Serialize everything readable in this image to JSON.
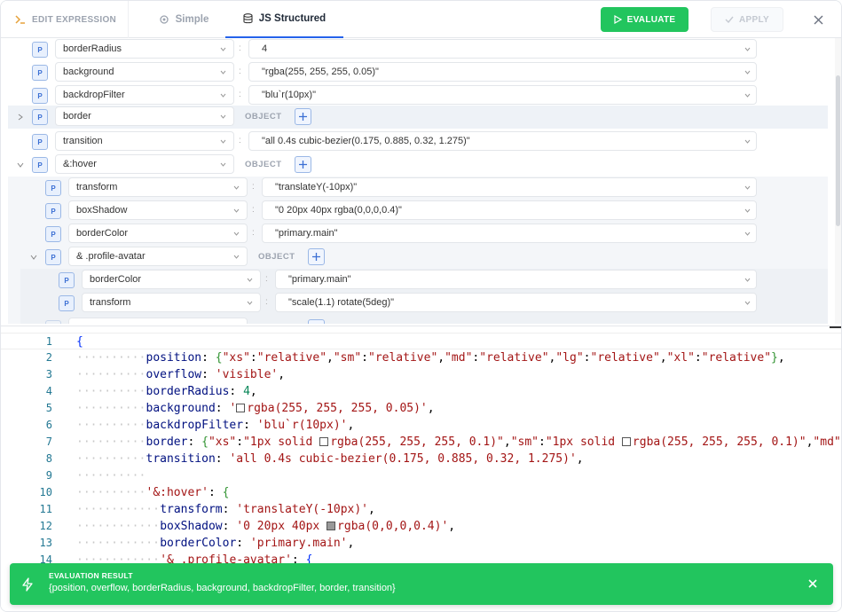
{
  "header": {
    "tabs": [
      {
        "label": "EDIT EXPRESSION",
        "icon": "terminal-icon"
      },
      {
        "label": "Simple",
        "icon": "gear-icon"
      },
      {
        "label": "JS Structured",
        "icon": "database-icon"
      }
    ],
    "evaluate_label": "EVALUATE",
    "apply_label": "APPLY"
  },
  "tree": {
    "rows": [
      {
        "badge": "P",
        "key": "borderRadius",
        "value": "4"
      },
      {
        "badge": "P",
        "key": "background",
        "value": "\"rgba(255, 255, 255, 0.05)\""
      },
      {
        "badge": "P",
        "key": "backdropFilter",
        "value": "\"blu`r(10px)\""
      },
      {
        "badge": "P",
        "key": "border",
        "object_label": "OBJECT",
        "expanded": false
      },
      {
        "badge": "P",
        "key": "transition",
        "value": "\"all 0.4s cubic-bezier(0.175, 0.885, 0.32, 1.275)\""
      },
      {
        "badge": "P",
        "key": "&:hover",
        "object_label": "OBJECT",
        "expanded": true
      },
      {
        "badge": "P",
        "key": "transform",
        "value": "\"translateY(-10px)\""
      },
      {
        "badge": "P",
        "key": "boxShadow",
        "value": "\"0 20px 40px rgba(0,0,0,0.4)\""
      },
      {
        "badge": "P",
        "key": "borderColor",
        "value": "\"primary.main\""
      },
      {
        "badge": "P",
        "key": "& .profile-avatar",
        "object_label": "OBJECT",
        "expanded": true
      },
      {
        "badge": "P",
        "key": "borderColor",
        "value": "\"primary.main\""
      },
      {
        "badge": "P",
        "key": "transform",
        "value": "\"scale(1.1) rotate(5deg)\""
      }
    ]
  },
  "editor": {
    "lines": [
      {
        "n": "1",
        "indent": 0,
        "tokens": [
          [
            "b1",
            "{"
          ]
        ]
      },
      {
        "n": "2",
        "indent": 1,
        "tokens": [
          [
            "k",
            "position"
          ],
          [
            "p",
            ": "
          ],
          [
            "b2",
            "{"
          ],
          [
            "s",
            "\"xs\""
          ],
          [
            "p",
            ":"
          ],
          [
            "s",
            "\"relative\""
          ],
          [
            "p",
            ","
          ],
          [
            "s",
            "\"sm\""
          ],
          [
            "p",
            ":"
          ],
          [
            "s",
            "\"relative\""
          ],
          [
            "p",
            ","
          ],
          [
            "s",
            "\"md\""
          ],
          [
            "p",
            ":"
          ],
          [
            "s",
            "\"relative\""
          ],
          [
            "p",
            ","
          ],
          [
            "s",
            "\"lg\""
          ],
          [
            "p",
            ":"
          ],
          [
            "s",
            "\"relative\""
          ],
          [
            "p",
            ","
          ],
          [
            "s",
            "\"xl\""
          ],
          [
            "p",
            ":"
          ],
          [
            "s",
            "\"relative\""
          ],
          [
            "b2",
            "}"
          ],
          [
            "p",
            ","
          ]
        ]
      },
      {
        "n": "3",
        "indent": 1,
        "tokens": [
          [
            "k",
            "overflow"
          ],
          [
            "p",
            ": "
          ],
          [
            "s",
            "'visible'"
          ],
          [
            "p",
            ","
          ]
        ]
      },
      {
        "n": "4",
        "indent": 1,
        "tokens": [
          [
            "k",
            "borderRadius"
          ],
          [
            "p",
            ": "
          ],
          [
            "n",
            "4"
          ],
          [
            "p",
            ","
          ]
        ]
      },
      {
        "n": "5",
        "indent": 1,
        "tokens": [
          [
            "k",
            "background"
          ],
          [
            "p",
            ": "
          ],
          [
            "s",
            "'"
          ],
          [
            "sw",
            "rgba(255,255,255,0.05)"
          ],
          [
            "s",
            "rgba(255, 255, 255, 0.05)'"
          ],
          [
            "p",
            ","
          ]
        ]
      },
      {
        "n": "6",
        "indent": 1,
        "tokens": [
          [
            "k",
            "backdropFilter"
          ],
          [
            "p",
            ": "
          ],
          [
            "s",
            "'blu`r(10px)'"
          ],
          [
            "p",
            ","
          ]
        ]
      },
      {
        "n": "7",
        "indent": 1,
        "tokens": [
          [
            "k",
            "border"
          ],
          [
            "p",
            ": "
          ],
          [
            "b2",
            "{"
          ],
          [
            "s",
            "\"xs\""
          ],
          [
            "p",
            ":"
          ],
          [
            "s",
            "\"1px solid "
          ],
          [
            "sw",
            "rgba(255,255,255,0.1)"
          ],
          [
            "s",
            "rgba(255, 255, 255, 0.1)\""
          ],
          [
            "p",
            ","
          ],
          [
            "s",
            "\"sm\""
          ],
          [
            "p",
            ":"
          ],
          [
            "s",
            "\"1px solid "
          ],
          [
            "sw",
            "rgba(255,255,255,0.1)"
          ],
          [
            "s",
            "rgba(255, 255, 255, 0.1)\""
          ],
          [
            "p",
            ","
          ],
          [
            "s",
            "\"md\""
          ],
          [
            "p",
            ":"
          ]
        ]
      },
      {
        "n": "8",
        "indent": 1,
        "tokens": [
          [
            "k",
            "transition"
          ],
          [
            "p",
            ": "
          ],
          [
            "s",
            "'all 0.4s cubic-bezier(0.175, 0.885, 0.32, 1.275)'"
          ],
          [
            "p",
            ","
          ]
        ]
      },
      {
        "n": "9",
        "indent": 1,
        "tokens": []
      },
      {
        "n": "10",
        "indent": 1,
        "tokens": [
          [
            "s",
            "'&:hover'"
          ],
          [
            "p",
            ": "
          ],
          [
            "b2",
            "{"
          ]
        ]
      },
      {
        "n": "11",
        "indent": 2,
        "tokens": [
          [
            "k",
            "transform"
          ],
          [
            "p",
            ": "
          ],
          [
            "s",
            "'translateY(-10px)'"
          ],
          [
            "p",
            ","
          ]
        ]
      },
      {
        "n": "12",
        "indent": 2,
        "tokens": [
          [
            "k",
            "boxShadow"
          ],
          [
            "p",
            ": "
          ],
          [
            "s",
            "'0 20px 40px "
          ],
          [
            "sw",
            "rgba(0,0,0,0.4)"
          ],
          [
            "s",
            "rgba(0,0,0,0.4)'"
          ],
          [
            "p",
            ","
          ]
        ]
      },
      {
        "n": "13",
        "indent": 2,
        "tokens": [
          [
            "k",
            "borderColor"
          ],
          [
            "p",
            ": "
          ],
          [
            "s",
            "'primary.main'"
          ],
          [
            "p",
            ","
          ]
        ]
      },
      {
        "n": "14",
        "indent": 2,
        "tokens": [
          [
            "s",
            "'& .profile-avatar'"
          ],
          [
            "p",
            ": "
          ],
          [
            "b1",
            "{"
          ]
        ]
      }
    ]
  },
  "toast": {
    "title": "EVALUATION RESULT",
    "message": "{position, overflow, borderRadius, background, backdropFilter, border, transition}"
  },
  "colors": {
    "accent": "#2563eb",
    "success": "#22c55e",
    "badge_border": "#9bb8e6"
  }
}
